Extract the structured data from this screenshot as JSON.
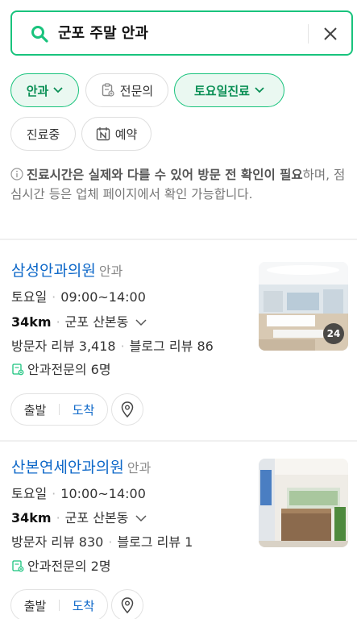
{
  "search": {
    "query": "군포 주말 안과"
  },
  "filters": [
    {
      "label": "안과",
      "active": true,
      "dropdown": true
    },
    {
      "label": "전문의",
      "active": false,
      "icon": "specialist-doc-icon"
    },
    {
      "label": "토요일진료",
      "active": true,
      "dropdown": true
    },
    {
      "label": "진료중",
      "active": false
    },
    {
      "label": "예약",
      "active": false,
      "icon": "naver-booking-icon"
    }
  ],
  "notice": {
    "bold": "진료시간은 실제와 다를 수 있어 방문 전 확인이 필요",
    "rest": "하며, 점심시간 등은 업체 페이지에서 확인 가능합니다."
  },
  "results": [
    {
      "name": "삼성안과의원",
      "category": "안과",
      "day": "토요일",
      "hours": "09:00~14:00",
      "distance": "34km",
      "area": "군포 산본동",
      "visitor_reviews": "방문자 리뷰 3,418",
      "blog_reviews": "블로그 리뷰 86",
      "specialists": "안과전문의 6명",
      "photo_count": "24",
      "start_label": "출발",
      "arrive_label": "도착"
    },
    {
      "name": "산본연세안과의원",
      "category": "안과",
      "day": "토요일",
      "hours": "10:00~14:00",
      "distance": "34km",
      "area": "군포 산본동",
      "visitor_reviews": "방문자 리뷰 830",
      "blog_reviews": "블로그 리뷰 1",
      "specialists": "안과전문의 2명",
      "start_label": "출발",
      "arrive_label": "도착"
    }
  ],
  "colors": {
    "accent": "#19c37d",
    "link": "#0c67c8"
  }
}
